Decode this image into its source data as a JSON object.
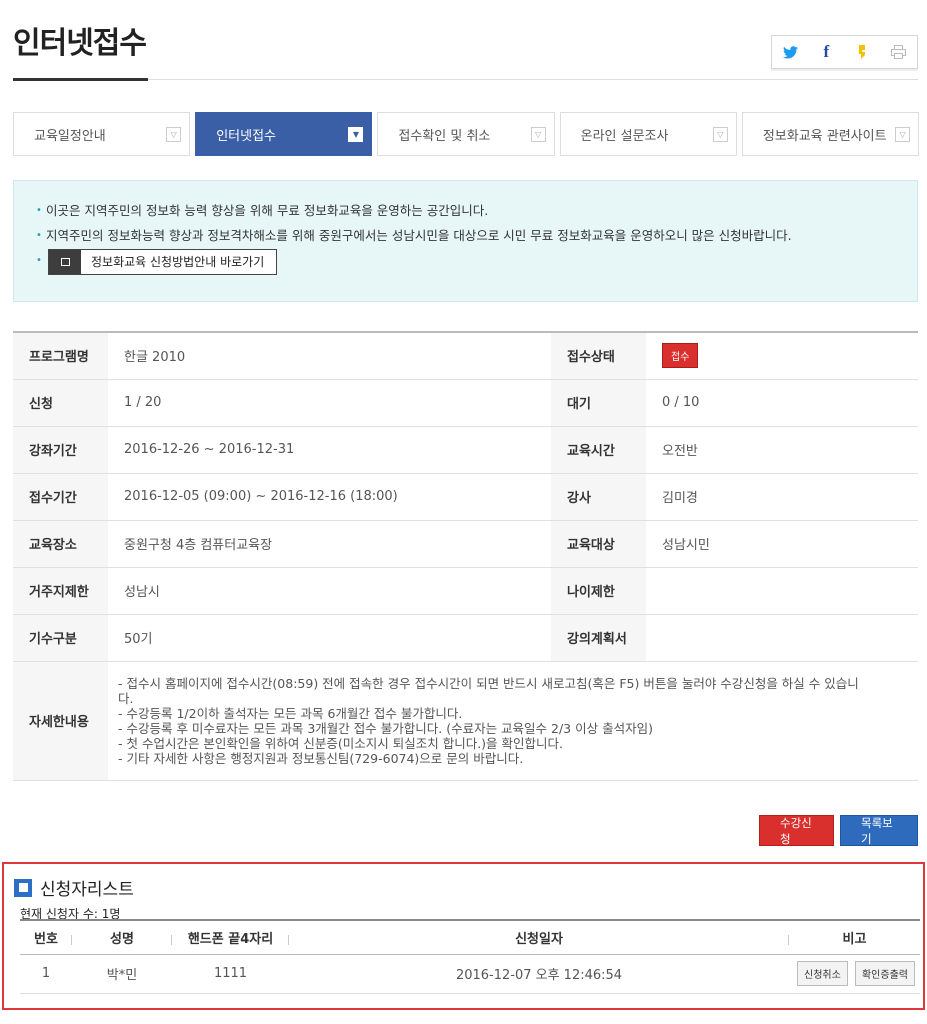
{
  "page": {
    "title": "인터넷접수"
  },
  "share": {
    "twitter_icon": "twitter-icon",
    "facebook_icon": "facebook-icon",
    "kakaostory_icon": "kakaostory-icon",
    "print_icon": "print-icon"
  },
  "tabs": [
    {
      "label": "교육일정안내",
      "active": false
    },
    {
      "label": "인터넷접수",
      "active": true
    },
    {
      "label": "접수확인 및 취소",
      "active": false
    },
    {
      "label": "온라인 설문조사",
      "active": false
    },
    {
      "label": "정보화교육 관련사이트",
      "active": false
    }
  ],
  "notice": {
    "line1": "이곳은 지역주민의 정보화 능력 향상을 위해 무료 정보화교육을 운영하는 공간입니다.",
    "line2": "지역주민의 정보화능력 향상과 정보격차해소를 위해 중원구에서는 성남시민을 대상으로 시민 무료 정보화교육을 운영하오니 많은 신청바랍니다.",
    "link_label": "정보화교육 신청방법안내 바로가기"
  },
  "info": {
    "program_label": "프로그램명",
    "program_value": "한글 2010",
    "status_label": "접수상태",
    "status_value": "접수",
    "apply_label": "신청",
    "apply_value": "1 / 20",
    "wait_label": "대기",
    "wait_value": "0 / 10",
    "period_label": "강좌기간",
    "period_value": "2016-12-26 ~ 2016-12-31",
    "time_label": "교육시간",
    "time_value": "오전반",
    "reception_label": "접수기간",
    "reception_value": "2016-12-05 (09:00) ~ 2016-12-16 (18:00)",
    "teacher_label": "강사",
    "teacher_value": "김미경",
    "place_label": "교육장소",
    "place_value": "중원구청 4층 컴퓨터교육장",
    "target_label": "교육대상",
    "target_value": "성남시민",
    "residence_label": "거주지제한",
    "residence_value": "성남시",
    "age_label": "나이제한",
    "age_value": "",
    "term_label": "기수구분",
    "term_value": "50기",
    "plan_label": "강의계획서",
    "plan_value": "",
    "detail_label": "자세한내용",
    "detail_lines": [
      "- 접수시 홈페이지에 접수시간(08:59) 전에 접속한 경우 접수시간이 되면 반드시 새로고침(혹은 F5) 버튼을 눌러야 수강신청을 하실 수 있습니",
      "다.",
      "- 수강등록 1/2이하 출석자는 모든 과목 6개월간 접수 불가합니다.",
      "- 수강등록 후 미수료자는 모든 과목 3개월간 접수 불가합니다. (수료자는 교육일수 2/3 이상 출석자임)",
      "- 첫 수업시간은 본인확인을 위하여 신분증(미소지시 퇴실조치 합니다.)을 확인합니다.",
      "- 기타 자세한 사항은 행정지원과 정보통신팀(729-6074)으로 문의 바랍니다."
    ]
  },
  "actions": {
    "apply_label": "수강신청",
    "list_label": "목록보기"
  },
  "applicants": {
    "title": "신청자리스트",
    "count_text": "현재 신청자 수: 1명",
    "headers": {
      "no": "번호",
      "name": "성명",
      "phone": "핸드폰 끝4자리",
      "date": "신청일자",
      "note": "비고"
    },
    "rows": [
      {
        "no": "1",
        "name": "박*민",
        "phone": "1111",
        "date": "2016-12-07 오후 12:46:54",
        "cancel_label": "신청취소",
        "cert_label": "확인증출력"
      }
    ]
  }
}
